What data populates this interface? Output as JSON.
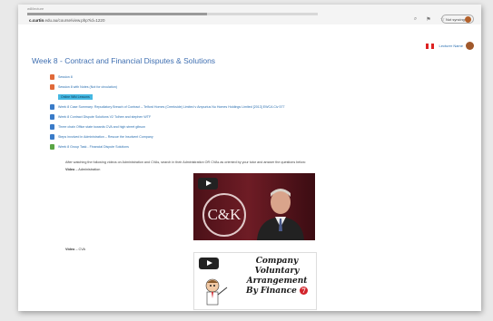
{
  "browser": {
    "tab_title": "w8/lecture",
    "url_prefix": "c.curtin",
    "url_path": ".edu.au/course/view.php?id=1220",
    "profile_label": "Not syncing",
    "page_load_progress": 0.62
  },
  "user": {
    "name": "Lecturer Name"
  },
  "page": {
    "title": "Week 8 - Contract and Financial Disputes & Solutions"
  },
  "items": [
    {
      "icon": "pdf",
      "label": "Session 8"
    },
    {
      "icon": "pdf",
      "label": "Session 8 with Notes (Not for circulation)"
    },
    {
      "icon": "highlight",
      "label": "Online Wiki Lessons"
    },
    {
      "icon": "doc",
      "label": "Week 8 Case Summary: Repudiatory Breach of Contract – Telford Homes (Creekside) Limited v Ampurius Nu Homes Holdings Limited [2013] EWCA Civ 577"
    },
    {
      "icon": "doc",
      "label": "Week 8 Contract Dispute Solutions V2 Tolhee and stephen WTF"
    },
    {
      "icon": "doc",
      "label": "Three chain Office state towards CVA and high street gibson"
    },
    {
      "icon": "doc",
      "label": "Steps involved in Administration – Rescue the Insolvent Company"
    },
    {
      "icon": "forum",
      "label": "Week 8 Group Task - Financial Dispute Solutions"
    }
  ],
  "instructions": "After watching the following videos on Administration and CVAs, search in their Administration OR CVAs as oriented by your tutor and answer the questions below:",
  "videos": [
    {
      "label": "Video",
      "suffix": " – Administration",
      "logo": "C&K"
    },
    {
      "label": "Video",
      "suffix": " – CVA",
      "caption_line1": "Company Voluntary",
      "caption_line2": "Arrangement",
      "caption_line3": "By Finance",
      "badge": "7"
    }
  ],
  "colors": {
    "link": "#2a6fb0",
    "title": "#3f6fb1",
    "highlight": "#45b8e2",
    "pdf": "#e06a3a",
    "doc": "#3a7bc8",
    "forum": "#5aa545",
    "video_bg": "#5a151d"
  }
}
